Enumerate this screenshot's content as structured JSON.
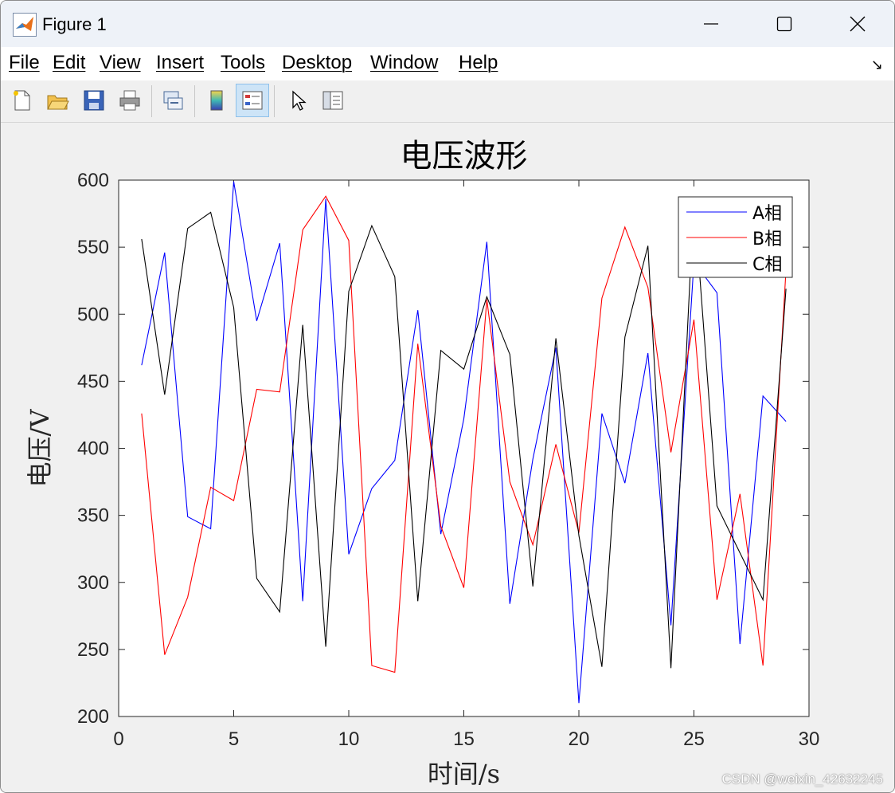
{
  "window": {
    "title": "Figure 1",
    "controls": {
      "minimize": "—",
      "maximize": "☐",
      "close": "✕"
    }
  },
  "menu": {
    "items": [
      "File",
      "Edit",
      "View",
      "Insert",
      "Tools",
      "Desktop",
      "Window",
      "Help"
    ],
    "dock_icon": "↘"
  },
  "toolbar": {
    "buttons": [
      {
        "icon": "new-figure-icon"
      },
      {
        "icon": "open-file-icon"
      },
      {
        "icon": "save-icon"
      },
      {
        "icon": "print-icon"
      },
      {
        "icon": "link-plot-icon"
      },
      {
        "icon": "colorbar-icon"
      },
      {
        "icon": "legend-icon",
        "active": true
      },
      {
        "icon": "pointer-icon"
      },
      {
        "icon": "property-editor-icon"
      }
    ]
  },
  "watermark": "CSDN @weixin_42632245",
  "chart_data": {
    "type": "line",
    "title": "电压波形",
    "xlabel": "时间/s",
    "ylabel": "电压/V",
    "xlim": [
      0,
      30
    ],
    "ylim": [
      200,
      600
    ],
    "xticks": [
      "0",
      "5",
      "10",
      "15",
      "20",
      "25",
      "30"
    ],
    "yticks": [
      "200",
      "250",
      "300",
      "350",
      "400",
      "450",
      "500",
      "550",
      "600"
    ],
    "grid": false,
    "legend_position": "top-right",
    "x": [
      1,
      2,
      3,
      4,
      5,
      6,
      7,
      8,
      9,
      10,
      11,
      12,
      13,
      14,
      15,
      16,
      17,
      18,
      19,
      20,
      21,
      22,
      23,
      24,
      25,
      26,
      27,
      28,
      29
    ],
    "series": [
      {
        "name": "A相",
        "color": "#0000ff",
        "values": [
          462,
          546,
          349,
          340,
          599,
          495,
          553,
          286,
          586,
          321,
          370,
          391,
          503,
          336,
          422,
          554,
          284,
          392,
          475,
          210,
          426,
          374,
          471,
          268,
          539,
          516,
          254,
          439,
          420
        ]
      },
      {
        "name": "B相",
        "color": "#ff0000",
        "values": [
          426,
          246,
          289,
          371,
          361,
          444,
          442,
          563,
          588,
          555,
          238,
          233,
          478,
          342,
          296,
          511,
          375,
          328,
          403,
          337,
          512,
          565,
          520,
          397,
          496,
          287,
          366,
          238,
          533
        ]
      },
      {
        "name": "C相",
        "color": "#000000",
        "values": [
          556,
          440,
          564,
          576,
          505,
          303,
          278,
          492,
          252,
          517,
          566,
          528,
          286,
          473,
          459,
          513,
          470,
          297,
          482,
          335,
          237,
          483,
          551,
          236,
          587,
          357,
          322,
          287,
          519
        ]
      }
    ]
  }
}
